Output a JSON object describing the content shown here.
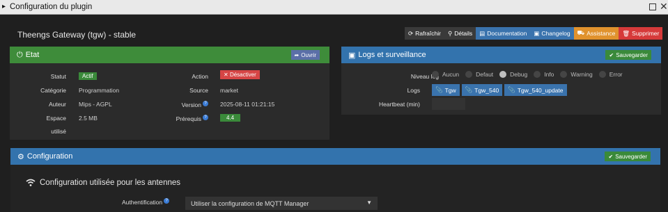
{
  "window": {
    "title": "Configuration du plugin"
  },
  "plugin": {
    "title": "Theengs Gateway (tgw) - stable"
  },
  "toolbar": {
    "refresh": "Rafraîchir",
    "details": "Détails",
    "documentation": "Documentation",
    "changelog": "Changelog",
    "assistance": "Assistance",
    "delete": "Supprimer"
  },
  "etat": {
    "title": "Etat",
    "open_button": "Ouvrir",
    "statut_label": "Statut",
    "statut_value": "Actif",
    "action_label": "Action",
    "action_button": "Désactiver",
    "categorie_label": "Catégorie",
    "categorie_value": "Programmation",
    "source_label": "Source",
    "source_value": "market",
    "auteur_label": "Auteur",
    "auteur_value": "Mips - AGPL",
    "version_label": "Version",
    "version_value": "2025-08-11 01:21:15",
    "espace_label": "Espace",
    "espace_label2": "utilisé",
    "espace_value": "2.5 MB",
    "prerequis_label": "Prérequis",
    "prerequis_value": "4.4"
  },
  "logs": {
    "title": "Logs et surveillance",
    "save_button": "Sauvegarder",
    "niveau_label": "Niveau log",
    "levels": [
      "Aucun",
      "Defaut",
      "Debug",
      "Info",
      "Warning",
      "Error"
    ],
    "selected_level": "Debug",
    "logs_label": "Logs",
    "log_files": [
      "Tgw",
      "Tgw_540",
      "Tgw_540_update"
    ],
    "heartbeat_label": "Heartbeat (min)",
    "heartbeat_value": ""
  },
  "config": {
    "title": "Configuration",
    "save_button": "Sauvegarder",
    "subtitle": "Configuration utilisée pour les antennes",
    "auth_label": "Authentification",
    "auth_value": "Utiliser la configuration de MQTT Manager"
  },
  "colors": {
    "green_header": "#3e8c3a",
    "blue_header": "#3373ad",
    "danger": "#d63a3a",
    "warning": "#e0922d"
  }
}
